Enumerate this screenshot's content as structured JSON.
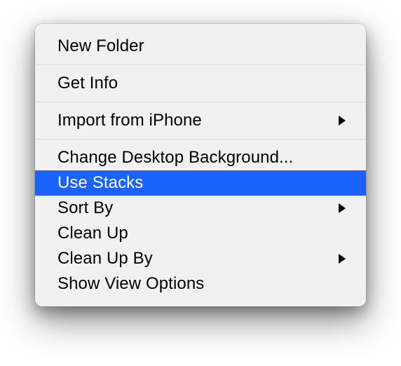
{
  "menu": {
    "highlight_color": "#1a63ff",
    "items": [
      {
        "label": "New Folder",
        "submenu": false,
        "highlighted": false
      },
      {
        "label": "Get Info",
        "submenu": false,
        "highlighted": false
      },
      {
        "label": "Import from iPhone",
        "submenu": true,
        "highlighted": false
      },
      {
        "label": "Change Desktop Background...",
        "submenu": false,
        "highlighted": false
      },
      {
        "label": "Use Stacks",
        "submenu": false,
        "highlighted": true
      },
      {
        "label": "Sort By",
        "submenu": true,
        "highlighted": false
      },
      {
        "label": "Clean Up",
        "submenu": false,
        "highlighted": false
      },
      {
        "label": "Clean Up By",
        "submenu": true,
        "highlighted": false
      },
      {
        "label": "Show View Options",
        "submenu": false,
        "highlighted": false
      }
    ]
  }
}
